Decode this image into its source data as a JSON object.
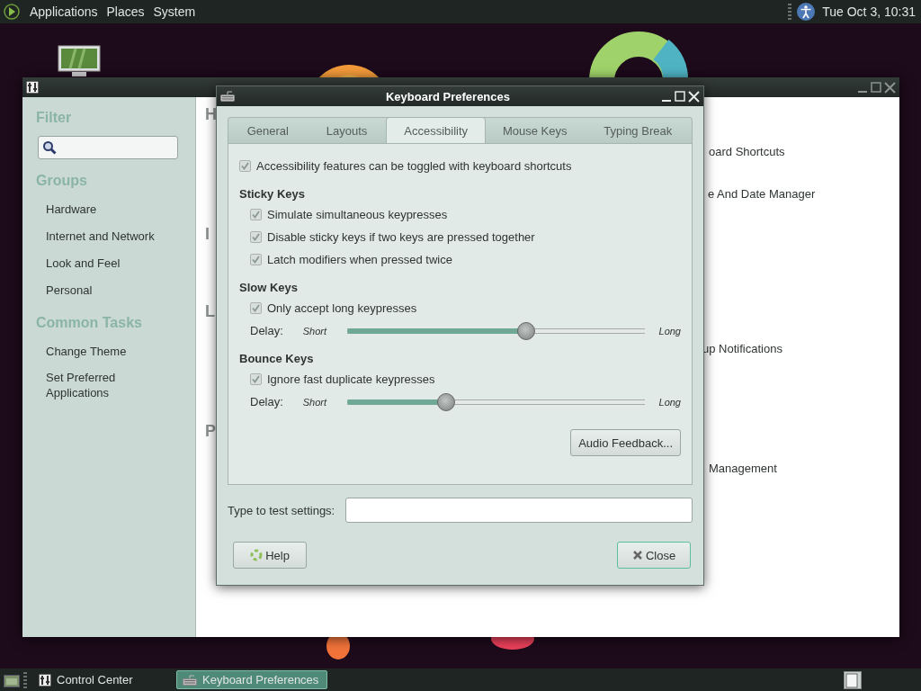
{
  "top_panel": {
    "menus": [
      "Applications",
      "Places",
      "System"
    ],
    "clock": "Tue Oct 3, 10:31"
  },
  "control_center": {
    "sidebar": {
      "filter_heading": "Filter",
      "groups_heading": "Groups",
      "groups": [
        "Hardware",
        "Internet and Network",
        "Look and Feel",
        "Personal"
      ],
      "tasks_heading": "Common Tasks",
      "tasks": [
        "Change Theme",
        "Set Preferred Applications"
      ]
    },
    "content": {
      "section_letters": [
        "H",
        "I",
        "L",
        "P"
      ],
      "items": [
        "oard Shortcuts",
        "e And Date Manager",
        "up Notifications",
        "Management"
      ]
    }
  },
  "dialog": {
    "title": "Keyboard Preferences",
    "tabs": [
      {
        "label": "General",
        "selected": false
      },
      {
        "label": "Layouts",
        "selected": false
      },
      {
        "label": "Accessibility",
        "selected": true
      },
      {
        "label": "Mouse Keys",
        "selected": false
      },
      {
        "label": "Typing Break",
        "selected": false
      }
    ],
    "toggle_option": {
      "label": "Accessibility features can be toggled with keyboard shortcuts",
      "checked": true
    },
    "sections": [
      {
        "heading": "Sticky Keys",
        "options": [
          {
            "label": "Simulate simultaneous keypresses",
            "checked": true
          },
          {
            "label": "Disable sticky keys if two keys are pressed together",
            "checked": true
          },
          {
            "label": "Latch modifiers when pressed twice",
            "checked": true
          }
        ]
      },
      {
        "heading": "Slow Keys",
        "options": [
          {
            "label": "Only accept long keypresses",
            "checked": true
          }
        ],
        "delay": {
          "label": "Delay:",
          "min_label": "Short",
          "max_label": "Long",
          "level": 0.6
        }
      },
      {
        "heading": "Bounce Keys",
        "options": [
          {
            "label": "Ignore fast duplicate keypresses",
            "checked": true
          }
        ],
        "delay": {
          "label": "Delay:",
          "min_label": "Short",
          "max_label": "Long",
          "level": 0.33
        }
      }
    ],
    "audio_button": "Audio Feedback...",
    "test_field": {
      "label": "Type to test settings:"
    },
    "buttons": [
      {
        "kind": "help",
        "label": "Help"
      },
      {
        "kind": "close",
        "label": "Close"
      }
    ]
  },
  "taskbar": {
    "items": [
      {
        "label": "Control Center",
        "selected": false
      },
      {
        "label": "Keyboard Preferences",
        "selected": true
      }
    ]
  }
}
